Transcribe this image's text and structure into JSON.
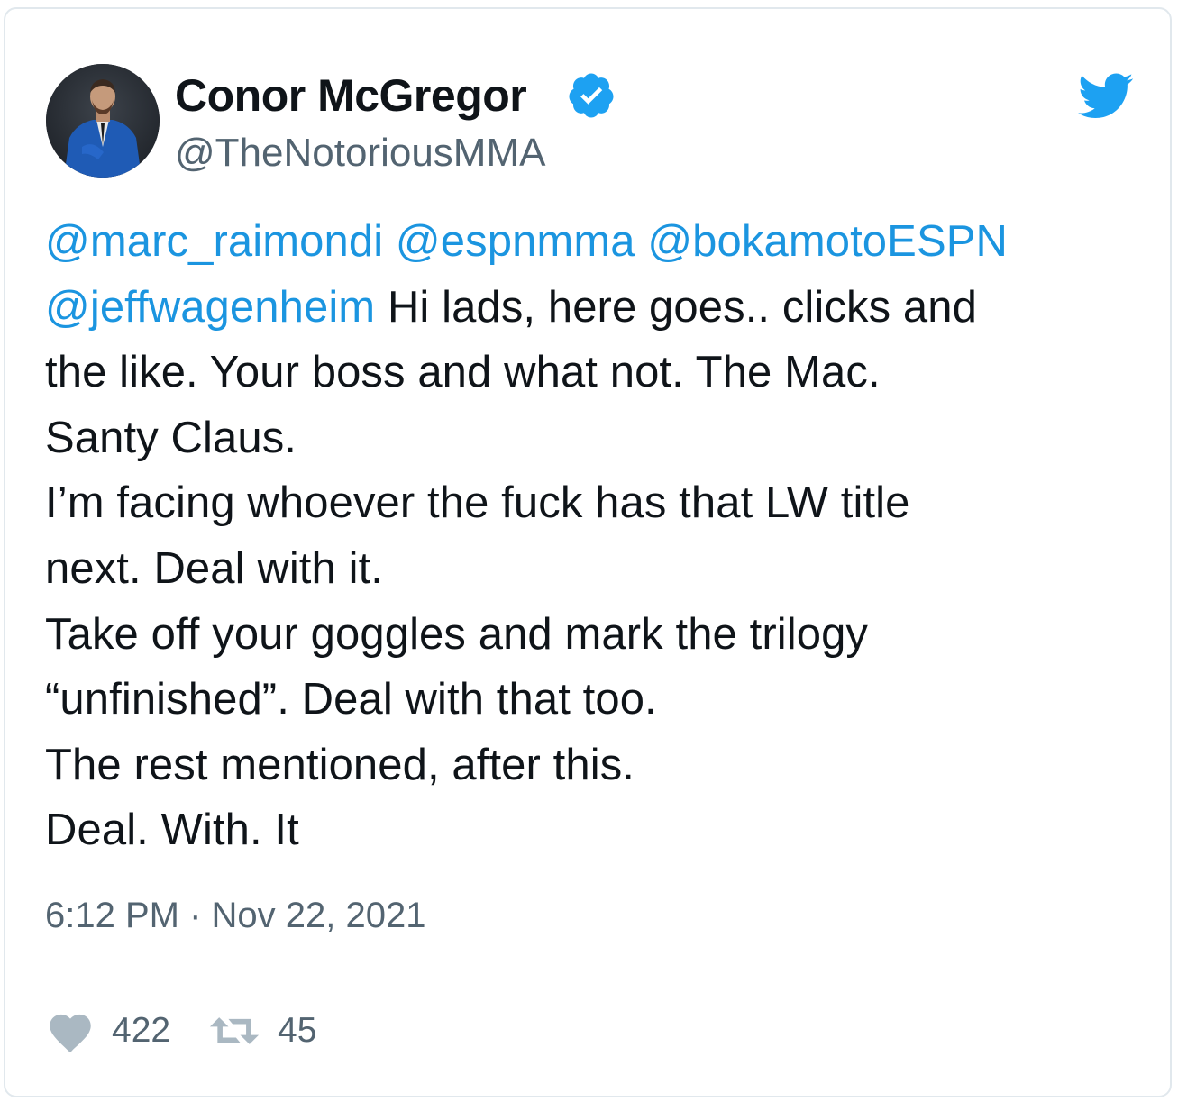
{
  "author": {
    "display_name": "Conor McGregor",
    "handle": "@TheNotoriousMMA",
    "verified": true,
    "avatar_icon": "profile-photo"
  },
  "brand": {
    "icon": "twitter-bird-icon",
    "color": "#1da1f2"
  },
  "tweet": {
    "lines": [
      [
        {
          "text": "@marc_raimondi",
          "mention": true
        },
        {
          "text": " ",
          "mention": false
        },
        {
          "text": "@espnmma",
          "mention": true
        },
        {
          "text": " ",
          "mention": false
        },
        {
          "text": "@bokamotoESPN",
          "mention": true
        }
      ],
      [
        {
          "text": "@jeffwagenheim",
          "mention": true
        },
        {
          "text": " Hi lads, here goes.. clicks and",
          "mention": false
        }
      ],
      [
        {
          "text": "the like. Your boss and what not. The Mac.",
          "mention": false
        }
      ],
      [
        {
          "text": "Santy Claus.",
          "mention": false
        }
      ],
      [
        {
          "text": "I’m facing whoever the fuck has that LW title",
          "mention": false
        }
      ],
      [
        {
          "text": "next. Deal with it.",
          "mention": false
        }
      ],
      [
        {
          "text": "Take off your goggles and mark the trilogy",
          "mention": false
        }
      ],
      [
        {
          "text": "“unfinished”. Deal with that too.",
          "mention": false
        }
      ],
      [
        {
          "text": "The rest mentioned, after this.",
          "mention": false
        }
      ],
      [
        {
          "text": "Deal. With. It",
          "mention": false
        }
      ]
    ],
    "timestamp": "6:12 PM · Nov 22, 2021"
  },
  "actions": {
    "likes": "422",
    "like_icon": "heart-icon",
    "retweets": "45",
    "retweet_icon": "retweet-icon"
  },
  "colors": {
    "mention": "#1b95e0",
    "secondary_text": "#536471",
    "verified_badge": "#1da1f2",
    "action_icon": "#aab8c2"
  }
}
